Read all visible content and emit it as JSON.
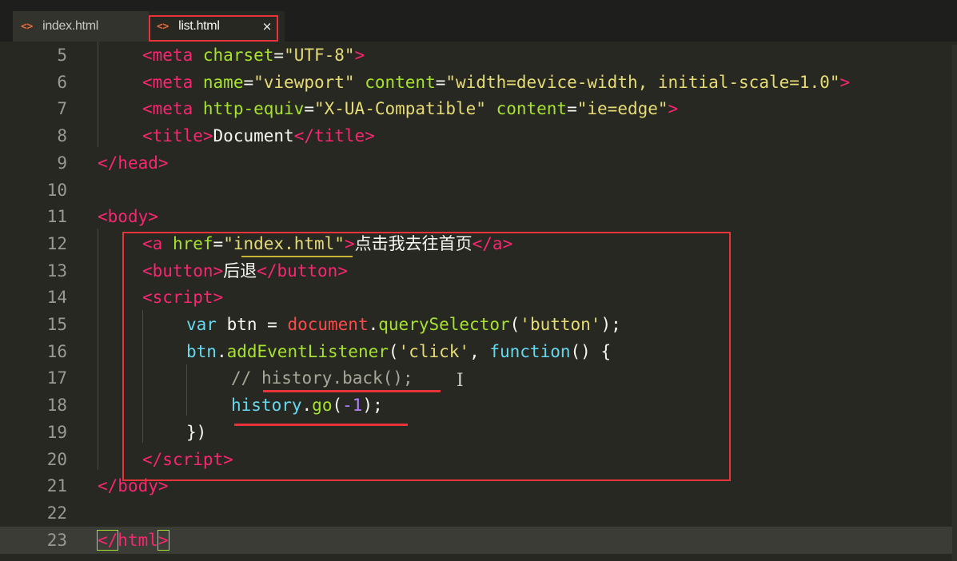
{
  "tabs": [
    {
      "label": "index.html",
      "icon": "code-icon",
      "active": false
    },
    {
      "label": "list.html",
      "icon": "code-icon",
      "active": true,
      "close": "×"
    }
  ],
  "lines": [
    {
      "num": "5"
    },
    {
      "num": "6"
    },
    {
      "num": "7"
    },
    {
      "num": "8"
    },
    {
      "num": "9"
    },
    {
      "num": "10"
    },
    {
      "num": "11"
    },
    {
      "num": "12"
    },
    {
      "num": "13"
    },
    {
      "num": "14"
    },
    {
      "num": "15"
    },
    {
      "num": "16"
    },
    {
      "num": "17"
    },
    {
      "num": "18"
    },
    {
      "num": "19"
    },
    {
      "num": "20"
    },
    {
      "num": "21"
    },
    {
      "num": "22"
    },
    {
      "num": "23"
    }
  ],
  "code": {
    "l5": [
      "<",
      "meta",
      " ",
      "charset",
      "=",
      "\"UTF-8\"",
      ">"
    ],
    "l6": [
      "<",
      "meta",
      " ",
      "name",
      "=",
      "\"viewport\"",
      " ",
      "content",
      "=",
      "\"width=device-width, initial-scale=1.0\"",
      ">"
    ],
    "l7": [
      "<",
      "meta",
      " ",
      "http-equiv",
      "=",
      "\"X-UA-Compatible\"",
      " ",
      "content",
      "=",
      "\"ie=edge\"",
      ">"
    ],
    "l8": [
      "<",
      "title",
      ">",
      "Document",
      "</",
      "title",
      ">"
    ],
    "l9": [
      "</",
      "head",
      ">"
    ],
    "l11": [
      "<",
      "body",
      ">"
    ],
    "l12": [
      "<",
      "a",
      " ",
      "href",
      "=",
      "\"",
      "index.html",
      "\"",
      ">",
      "点击我去往首页",
      "</",
      "a",
      ">"
    ],
    "l13": [
      "<",
      "button",
      ">",
      "后退",
      "</",
      "button",
      ">"
    ],
    "l14": [
      "<",
      "script",
      ">"
    ],
    "l15": [
      "var",
      " btn = ",
      "document",
      ".",
      "querySelector",
      "(",
      "'button'",
      ");"
    ],
    "l16": [
      "btn",
      ".",
      "addEventListener",
      "(",
      "'click'",
      ", ",
      "function",
      "() {"
    ],
    "l17": [
      "// ",
      "history.back();"
    ],
    "l18": [
      "history",
      ".",
      "go",
      "(",
      "-1",
      ");"
    ],
    "l19": [
      "})"
    ],
    "l20": [
      "</",
      "script",
      ">"
    ],
    "l21": [
      "</",
      "body",
      ">"
    ],
    "l23": [
      "</",
      "html",
      ">"
    ]
  },
  "colors": {
    "background": "#272822",
    "highlight_box": "#e8333b",
    "tag": "#f92672",
    "attr": "#a6e22e",
    "string": "#e6db74",
    "keyword": "#66d9ef",
    "number": "#ae81ff"
  }
}
